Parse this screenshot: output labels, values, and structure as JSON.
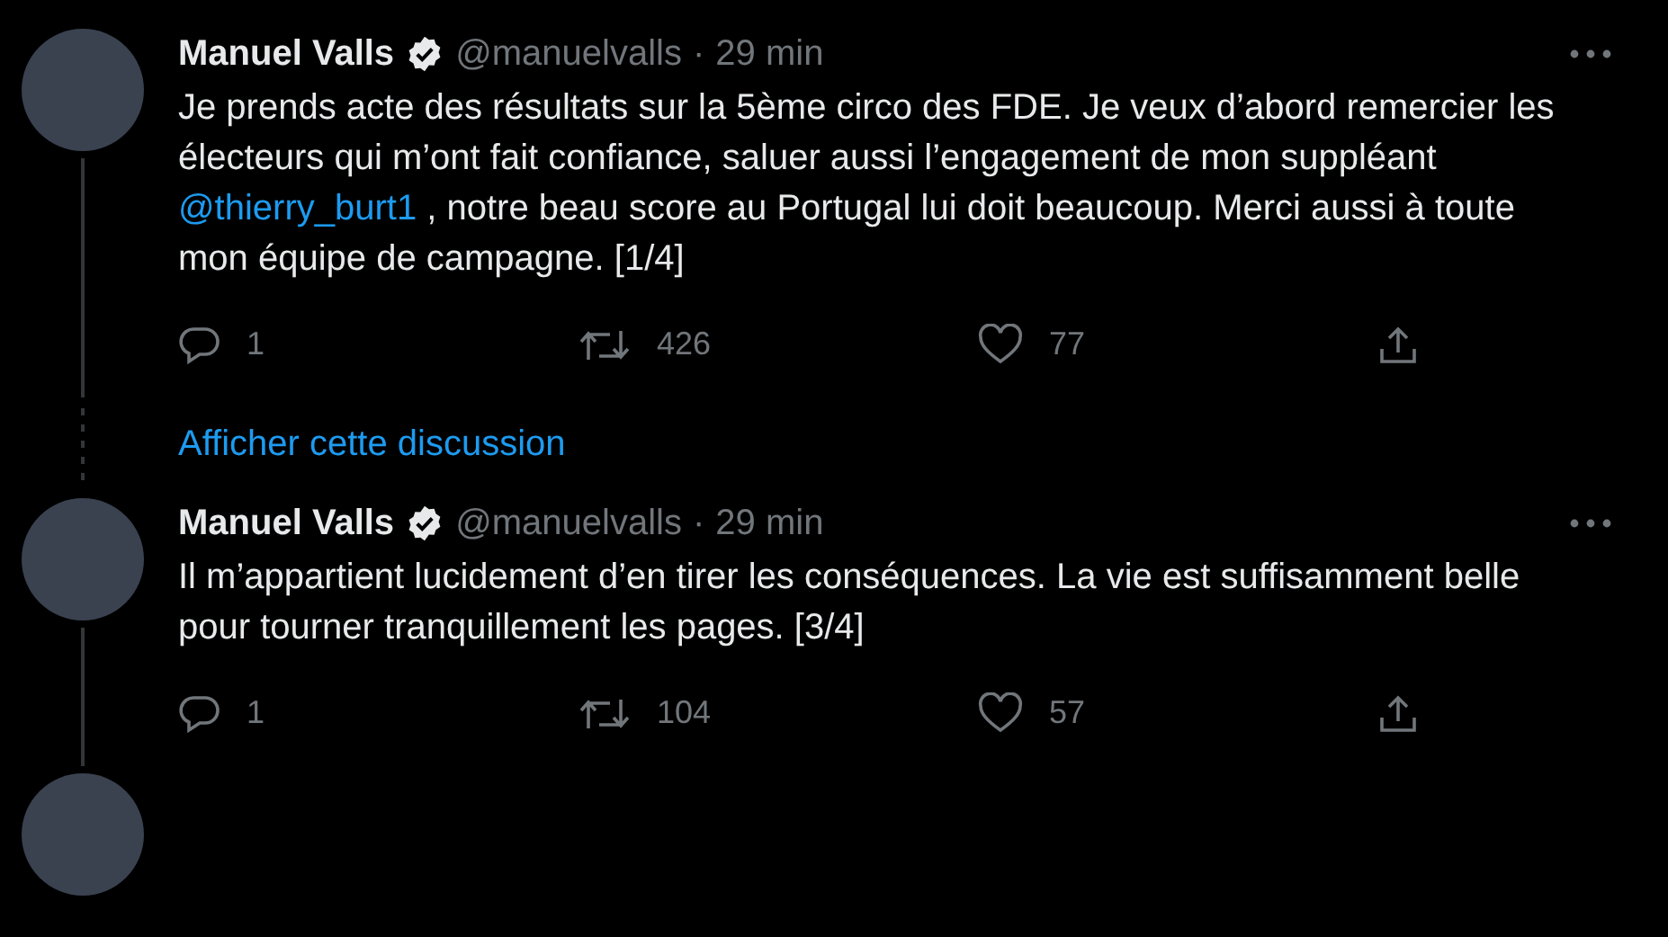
{
  "timeline": [
    {
      "kind": "tweet",
      "name": "Manuel Valls",
      "verified": true,
      "handle": "@manuelvalls",
      "separator": "·",
      "time": "29 min",
      "body": [
        {
          "kind": "text",
          "text": "Je prends acte des résultats sur la 5ème circo des FDE. Je veux d’abord remercier les électeurs qui m’ont fait confiance, saluer aussi l’engagement de mon suppléant "
        },
        {
          "kind": "mention",
          "text": "@thierry_burt1"
        },
        {
          "kind": "text",
          "text": " , notre beau score au Portugal lui doit beaucoup. Merci aussi à toute mon équipe de campagne. [1/4]"
        }
      ],
      "replies": "1",
      "retweets": "426",
      "likes": "77"
    },
    {
      "kind": "thread_link",
      "label": "Afficher cette discussion"
    },
    {
      "kind": "tweet",
      "name": "Manuel Valls",
      "verified": true,
      "handle": "@manuelvalls",
      "separator": "·",
      "time": "29 min",
      "body": [
        {
          "kind": "text",
          "text": "Il m’appartient lucidement d’en tirer les conséquences. La vie est suffisamment belle pour tourner tranquillement les pages. [3/4]"
        }
      ],
      "replies": "1",
      "retweets": "104",
      "likes": "57"
    },
    {
      "kind": "cut_tweet"
    }
  ]
}
